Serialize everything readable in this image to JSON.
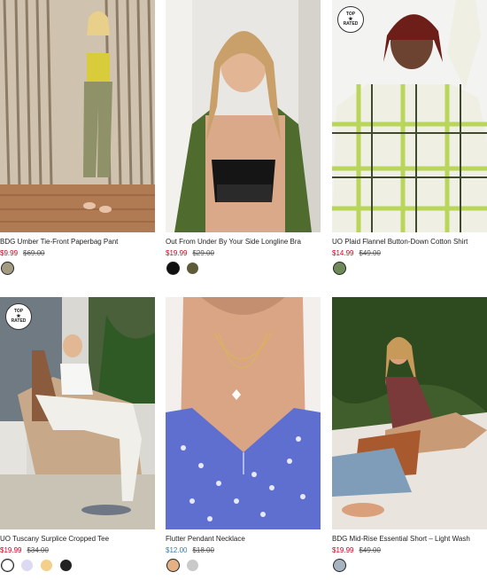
{
  "products": [
    {
      "title": "BDG Umber Tie-Front Paperbag Pant",
      "sale_price": "$9.99",
      "original_price": "$69.00",
      "badge": null,
      "swatches": [
        {
          "color": "#a39c83",
          "selected": true
        }
      ]
    },
    {
      "title": "Out From Under By Your Side Longline Bra",
      "sale_price": "$19.99",
      "original_price": "$29.00",
      "badge": null,
      "swatches": [
        {
          "color": "#111111",
          "selected": true
        },
        {
          "color": "#5d5b3a",
          "selected": false
        }
      ]
    },
    {
      "title": "UO Plaid Flannel Button-Down Cotton Shirt",
      "sale_price": "$14.99",
      "original_price": "$49.00",
      "badge": {
        "line1": "TOP",
        "star": "★",
        "line2": "RATED"
      },
      "swatches": [
        {
          "color": "#6f8a5a",
          "selected": true
        }
      ]
    },
    {
      "title": "UO Tuscany Surplice Cropped Tee",
      "sale_price": "$19.99",
      "original_price": "$34.00",
      "badge": {
        "line1": "TOP",
        "star": "★",
        "line2": "RATED"
      },
      "swatches": [
        {
          "color": "#ffffff",
          "selected": true
        },
        {
          "color": "#dcdaf0",
          "selected": false
        },
        {
          "color": "#f2cf8a",
          "selected": false
        },
        {
          "color": "#222222",
          "selected": false
        }
      ]
    },
    {
      "title": "Flutter Pendant Necklace",
      "sale_price": "$12.00",
      "original_price": "$18.00",
      "badge": null,
      "swatches": [
        {
          "color": "#e3b184",
          "selected": true
        },
        {
          "color": "#c9c9c9",
          "selected": false
        }
      ]
    },
    {
      "title": "BDG Mid-Rise Essential Short – Light Wash",
      "sale_price": "$19.99",
      "original_price": "$49.00",
      "badge": null,
      "swatches": [
        {
          "color": "#a7b4c0",
          "selected": true
        }
      ]
    }
  ],
  "colors": {
    "sale": "#d0021b"
  }
}
